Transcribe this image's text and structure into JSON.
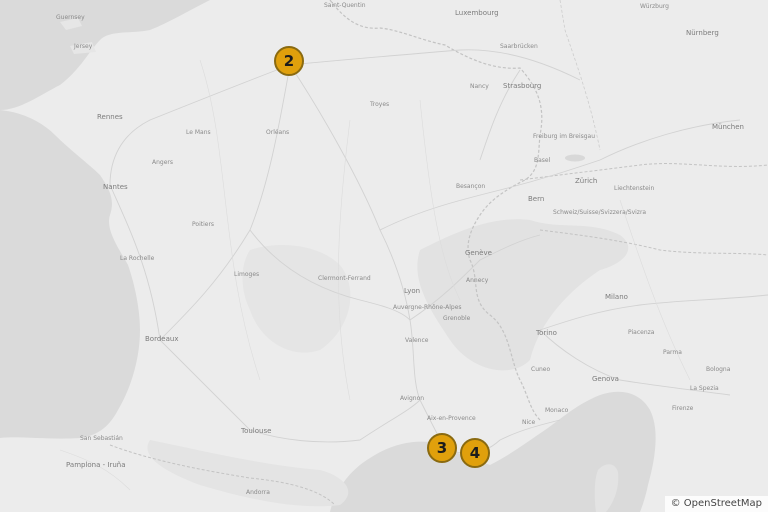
{
  "attribution": "© OpenStreetMap",
  "markers": [
    {
      "label": "2"
    },
    {
      "label": "3"
    },
    {
      "label": "4"
    }
  ],
  "places": {
    "guernsey": "Guernsey",
    "jersey": "Jersey",
    "rennes": "Rennes",
    "nantes": "Nantes",
    "lemans": "Le Mans",
    "angers": "Angers",
    "saint_quentin": "Saint-Quentin",
    "luxembourg": "Luxembourg",
    "wurzburg": "Würzburg",
    "saarbrucken": "Saarbrücken",
    "strasbourg": "Strasbourg",
    "nurnberg": "Nürnberg",
    "munchen": "München",
    "freiburg": "Freiburg im Breisgau",
    "zurich": "Zürich",
    "bern": "Bern",
    "liechtenstein": "Liechtenstein",
    "schweiz": "Schweiz/Suisse/Svizzera/Svizra",
    "basel": "Basel",
    "besancon": "Besançon",
    "orleans": "Orléans",
    "troyes": "Troyes",
    "nancy": "Nancy",
    "poitiers": "Poitiers",
    "larochelle": "La Rochelle",
    "limoges": "Limoges",
    "clermont": "Clermont-Ferrand",
    "lyon": "Lyon",
    "grenoble": "Grenoble",
    "annecy": "Annecy",
    "geneve": "Genève",
    "bordeaux": "Bordeaux",
    "toulouse": "Toulouse",
    "valence": "Valence",
    "avignon": "Avignon",
    "aix": "Aix-en-Provence",
    "nice": "Nice",
    "torino": "Torino",
    "milano": "Milano",
    "genova": "Genova",
    "cuneo": "Cuneo",
    "piacenza": "Piacenza",
    "parma": "Parma",
    "bologna": "Bologna",
    "firenze": "Firenze",
    "lyon_region": "Auvergne-Rhône-Alpes",
    "pamplona": "Pamplona - Iruña",
    "andorra": "Andorra",
    "san_sebastian": "San Sebastián",
    "la_spezia": "La Spezia",
    "monaco": "Monaco"
  }
}
